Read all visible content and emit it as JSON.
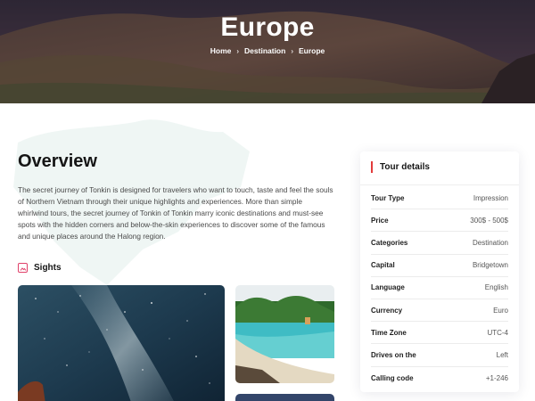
{
  "hero": {
    "title": "Europe",
    "breadcrumb": [
      "Home",
      "Destination",
      "Europe"
    ]
  },
  "overview": {
    "title": "Overview",
    "text": "The secret journey of Tonkin is designed for travelers who want to touch, taste and feel the souls of Northern Vietnam through their unique highlights and experiences. More than simple whirlwind tours, the secret journey of Tonkin of Tonkin marry iconic destinations and must-see spots with the hidden corners and below-the-skin experiences to discover some of the famous and unique places around the Halong region."
  },
  "sights": {
    "label": "Sights"
  },
  "tour_details": {
    "title": "Tour details",
    "rows": [
      {
        "label": "Tour Type",
        "value": "Impression"
      },
      {
        "label": "Price",
        "value": "300$ - 500$"
      },
      {
        "label": "Categories",
        "value": "Destination"
      },
      {
        "label": "Capital",
        "value": "Bridgetown"
      },
      {
        "label": "Language",
        "value": "English"
      },
      {
        "label": "Currency",
        "value": "Euro"
      },
      {
        "label": "Time Zone",
        "value": "UTC-4"
      },
      {
        "label": "Drives on the",
        "value": "Left"
      },
      {
        "label": "Calling code",
        "value": "+1-246"
      }
    ]
  },
  "colors": {
    "accent": "#e23b3b",
    "icon_accent": "#e0416a"
  }
}
